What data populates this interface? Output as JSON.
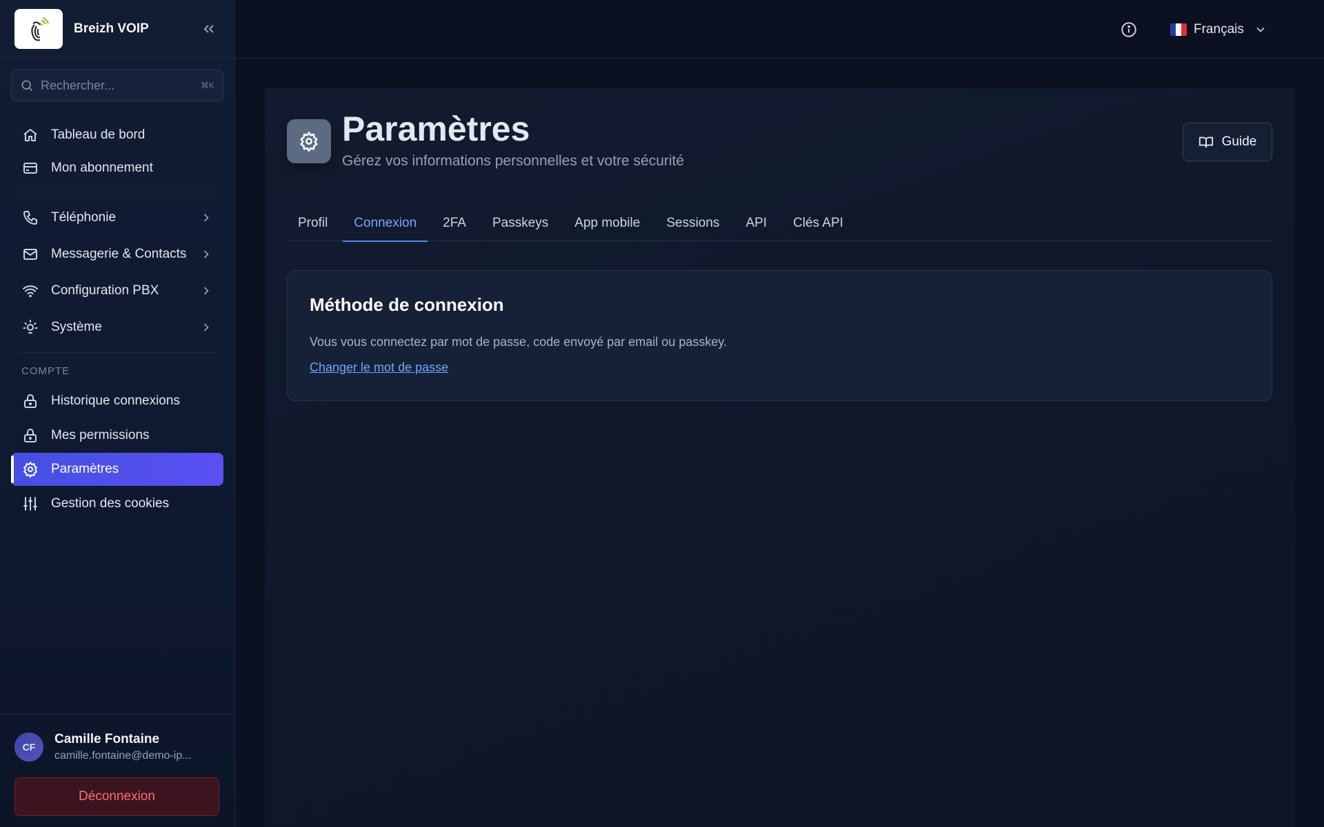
{
  "app": {
    "brand": "Breizh VOIP"
  },
  "search": {
    "placeholder": "Rechercher...",
    "shortcut": "⌘K"
  },
  "nav": {
    "primary": [
      {
        "label": "Tableau de bord",
        "icon": "home-icon"
      },
      {
        "label": "Mon abonnement",
        "icon": "credit-card-icon"
      }
    ],
    "groups": [
      {
        "label": "Téléphonie",
        "icon": "phone-icon"
      },
      {
        "label": "Messagerie & Contacts",
        "icon": "mail-icon"
      },
      {
        "label": "Configuration PBX",
        "icon": "wifi-icon"
      },
      {
        "label": "Système",
        "icon": "lightbulb-icon"
      }
    ],
    "section_title": "COMPTE",
    "account": [
      {
        "label": "Historique connexions",
        "icon": "lock-icon"
      },
      {
        "label": "Mes permissions",
        "icon": "lock-icon"
      },
      {
        "label": "Paramètres",
        "icon": "gear-icon",
        "active": true
      },
      {
        "label": "Gestion des cookies",
        "icon": "sliders-icon"
      }
    ]
  },
  "user": {
    "initials": "CF",
    "name": "Camille Fontaine",
    "email": "camille.fontaine@demo-ip...",
    "logout_label": "Déconnexion"
  },
  "topbar": {
    "language": "Français"
  },
  "page": {
    "title": "Paramètres",
    "subtitle": "Gérez vos informations personnelles et votre sécurité",
    "guide_label": "Guide"
  },
  "tabs": [
    {
      "label": "Profil"
    },
    {
      "label": "Connexion",
      "active": true
    },
    {
      "label": "2FA"
    },
    {
      "label": "Passkeys"
    },
    {
      "label": "App mobile"
    },
    {
      "label": "Sessions"
    },
    {
      "label": "API"
    },
    {
      "label": "Clés API"
    }
  ],
  "card": {
    "title": "Méthode de connexion",
    "text": "Vous vous connectez par mot de passe, code envoyé par email ou passkey.",
    "link": "Changer le mot de passe"
  },
  "colors": {
    "accent": "#4f5ae8",
    "link": "#6ea8fe",
    "danger": "#f87171"
  }
}
